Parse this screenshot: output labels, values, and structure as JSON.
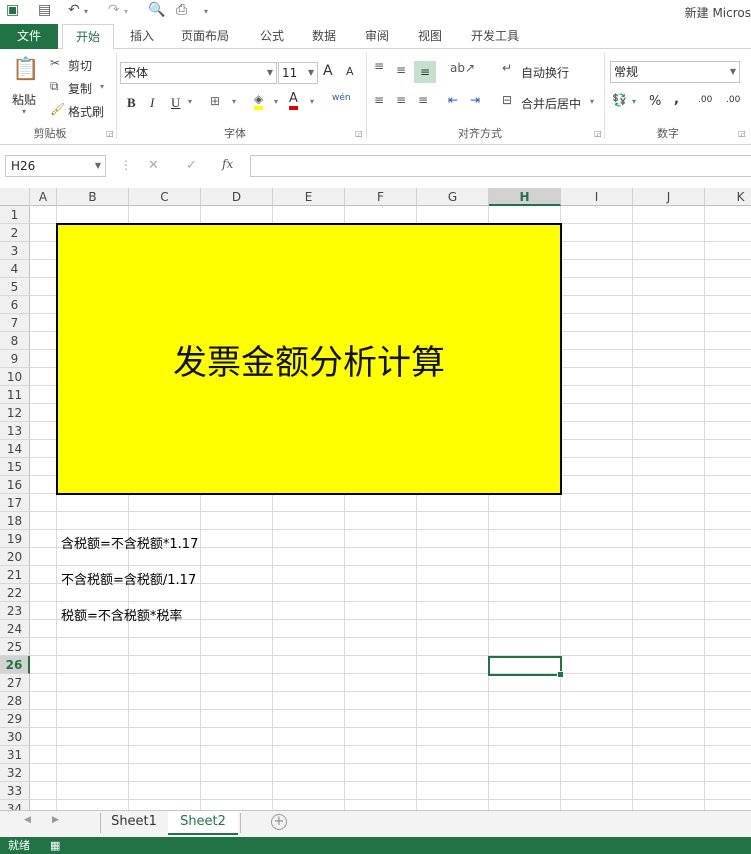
{
  "window": {
    "title": "新建 Micros"
  },
  "quick_access": {
    "excel_icon": "excel-logo-icon",
    "save_icon": "save-icon",
    "undo_icon": "undo-icon",
    "redo_icon": "redo-icon",
    "preview_icon": "print-preview-icon",
    "customize_icon": "customize-icon"
  },
  "tabs": [
    {
      "label": "文件"
    },
    {
      "label": "开始"
    },
    {
      "label": "插入"
    },
    {
      "label": "页面布局"
    },
    {
      "label": "公式"
    },
    {
      "label": "数据"
    },
    {
      "label": "审阅"
    },
    {
      "label": "视图"
    },
    {
      "label": "开发工具"
    }
  ],
  "ribbon": {
    "clipboard": {
      "paste": "粘贴",
      "cut": "剪切",
      "copy": "复制",
      "format_painter": "格式刷",
      "group": "剪贴板"
    },
    "font": {
      "name": "宋体",
      "size": "11",
      "bold": "B",
      "italic": "I",
      "underline": "U",
      "grow": "A",
      "shrink": "A",
      "phonetic": "wén",
      "group": "字体"
    },
    "alignment": {
      "wrap": "自动换行",
      "merge": "合并后居中",
      "group": "对齐方式"
    },
    "number": {
      "format": "常规",
      "percent": "%",
      "comma": ",",
      "inc_dec": ".00",
      "group": "数字"
    }
  },
  "formula_bar": {
    "namebox": "H26",
    "fx": "fx",
    "cancel": "✕",
    "confirm": "✓",
    "formula": ""
  },
  "grid": {
    "columns": [
      "A",
      "B",
      "C",
      "D",
      "E",
      "F",
      "G",
      "H",
      "I",
      "J",
      "K"
    ],
    "selected_column": "H",
    "rows": [
      "1",
      "2",
      "3",
      "4",
      "5",
      "6",
      "7",
      "8",
      "9",
      "10",
      "11",
      "12",
      "13",
      "14",
      "15",
      "16",
      "17",
      "18",
      "19",
      "20",
      "21",
      "22",
      "23",
      "24",
      "25",
      "26",
      "27",
      "28",
      "29",
      "30",
      "31",
      "32",
      "33",
      "34"
    ],
    "selected_row": "26",
    "banner_text": "发票金额分析计算",
    "cells": {
      "b19": "含税额=不含税额*1.17",
      "b21": "不含税额=含税额/1.17",
      "b23": "税额=不含税额*税率"
    }
  },
  "sheets": [
    {
      "name": "Sheet1"
    },
    {
      "name": "Sheet2"
    }
  ],
  "active_sheet": "Sheet2",
  "status": {
    "ready": "就绪"
  },
  "colors": {
    "accent": "#217346",
    "banner": "#ffff00"
  }
}
